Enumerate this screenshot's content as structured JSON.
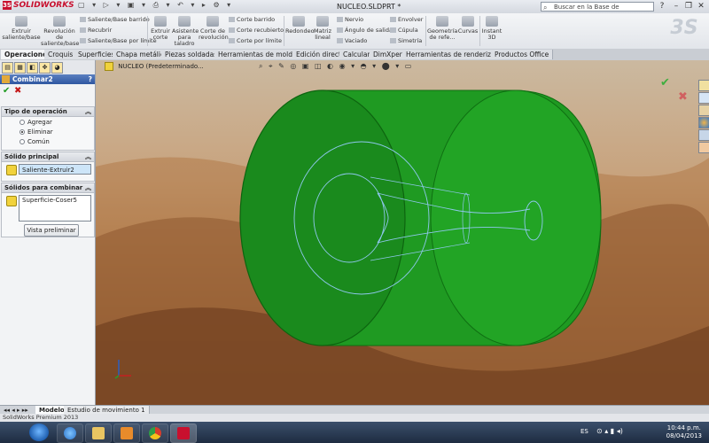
{
  "window": {
    "brand": "SOLIDWORKS",
    "doc_title": "NUCLEO.SLDPRT *",
    "kb_search_placeholder": "Buscar en la Base de conocimiento"
  },
  "ribbon": {
    "big": [
      {
        "label": "Extruir saliente/base"
      },
      {
        "label": "Revolución de saliente/base"
      },
      {
        "label": "Extruir corte"
      },
      {
        "label": "Asistente para taladro"
      },
      {
        "label": "Corte de revolución"
      },
      {
        "label": "Redondeo"
      },
      {
        "label": "Matriz lineal"
      },
      {
        "label": "Geometría de refe..."
      },
      {
        "label": "Curvas"
      },
      {
        "label": "Instant 3D"
      }
    ],
    "small": [
      "Saliente/Base barrido",
      "Recubrir",
      "Saliente/Base por límite",
      "Corte barrido",
      "Corte recubierto",
      "Corte por límite",
      "Nervio",
      "Ángulo de salida",
      "Vaciado",
      "Envolver",
      "Cúpula",
      "Simetría"
    ]
  },
  "tabs": [
    "Operaciones",
    "Croquis",
    "Superficies",
    "Chapa metálica",
    "Piezas soldadas",
    "Herramientas de moldes",
    "Edición directa",
    "Calcular",
    "DimXpert",
    "Herramientas de renderizado",
    "Productos Office"
  ],
  "panel": {
    "title": "Combinar2",
    "help": "?",
    "op_group": "Tipo de operación",
    "options": [
      "Agregar",
      "Eliminar",
      "Común"
    ],
    "selected_option": "Eliminar",
    "main_group": "Sólido principal",
    "main_value": "Saliente-Extruir2",
    "combine_group": "Sólidos para combinar",
    "combine_value": "Superficie-Coser5",
    "preview_button": "Vista preliminar"
  },
  "viewport": {
    "tree_label": "NUCLEO  (Predeterminado..."
  },
  "bottom": {
    "model_tabs": [
      "Modelo",
      "Estudio de movimiento 1"
    ],
    "status": "SolidWorks Premium 2013"
  },
  "taskbar": {
    "lang": "ES",
    "time": "10:44 p.m.",
    "date": "08/04/2013"
  },
  "colors": {
    "solid_green": "#1e9a1e",
    "accent_blue": "#2f57a1",
    "curve_blue": "#6fb4e6"
  },
  "icons": [
    "search-icon",
    "help-icon",
    "check-icon",
    "cancel-icon",
    "chevron-up-icon",
    "windows-start-icon",
    "ie-icon",
    "folder-icon",
    "media-player-icon",
    "chrome-icon",
    "solidworks-icon"
  ]
}
